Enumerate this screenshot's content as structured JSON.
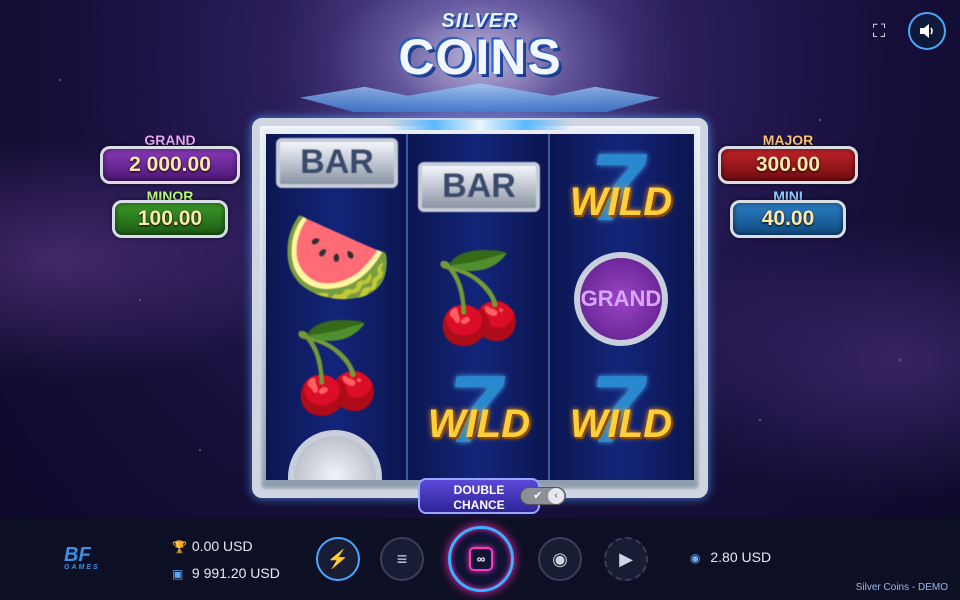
{
  "logo": {
    "line1": "SILVER",
    "line2": "COINS"
  },
  "jackpots": {
    "grand": {
      "label": "GRAND",
      "value": "2 000.00",
      "color": "#8a3ab8"
    },
    "minor": {
      "label": "MINOR",
      "value": "100.00",
      "color": "#3c9a2a"
    },
    "major": {
      "label": "MAJOR",
      "value": "300.00",
      "color": "#c2232a"
    },
    "mini": {
      "label": "MINI",
      "value": "40.00",
      "color": "#2a7fc4"
    }
  },
  "reels": {
    "reel1": {
      "top": "BAR",
      "melon": "🍉",
      "cherry": "🍒"
    },
    "reel2": {
      "top": "BAR",
      "cherry": "🍒",
      "wild": "WILD",
      "seven": "7"
    },
    "reel3": {
      "wild_top": "WILD",
      "seven": "7",
      "coin": "GRAND",
      "wild_bottom": "WILD"
    }
  },
  "double_chance": {
    "label_line1": "DOUBLE",
    "label_line2": "CHANCE",
    "toggle_state": "on"
  },
  "bottom_bar": {
    "brand": {
      "mark": "BF",
      "sub": "GAMES"
    },
    "win": {
      "icon": "trophy-icon",
      "value": "0.00 USD"
    },
    "balance": {
      "icon": "wallet-icon",
      "value": "9 991.20 USD"
    },
    "bet": {
      "icon": "coin-stack-icon",
      "value": "2.80 USD"
    },
    "controls": [
      {
        "name": "turbo",
        "icon": "lightning-icon",
        "glyph": "⚡"
      },
      {
        "name": "menu",
        "icon": "menu-icon",
        "glyph": "≡"
      },
      {
        "name": "spin",
        "icon": "infinity-icon",
        "glyph": "∞"
      },
      {
        "name": "bet-select",
        "icon": "coin-stack-icon",
        "glyph": "◉"
      },
      {
        "name": "autoplay",
        "icon": "play-icon",
        "glyph": "▶"
      }
    ]
  },
  "footer": {
    "title": "Silver Coins - DEMO"
  },
  "accent_color": "#3ab0ff"
}
